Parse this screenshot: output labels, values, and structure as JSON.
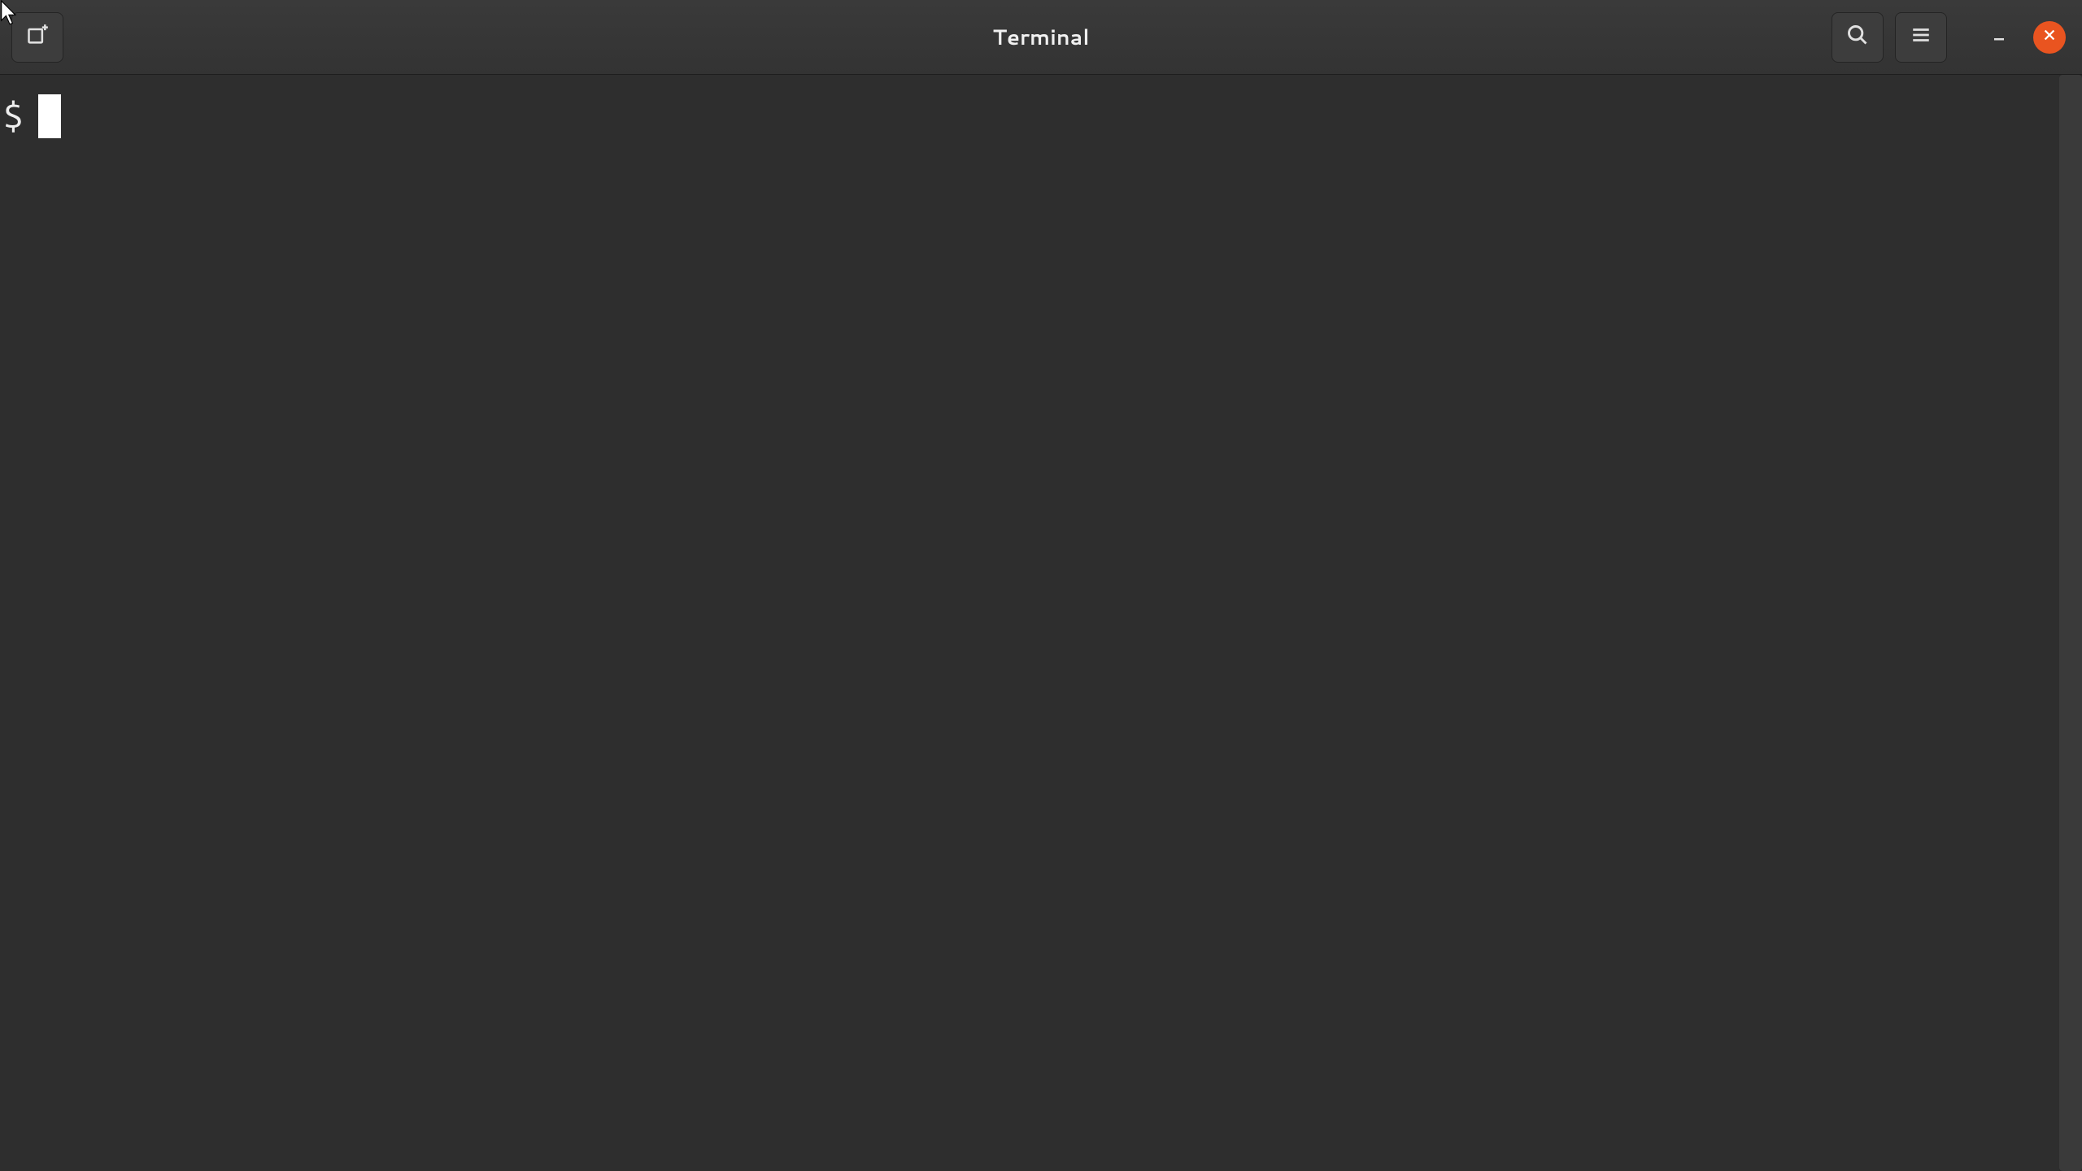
{
  "window": {
    "title": "Terminal"
  },
  "terminal": {
    "prompt": "$",
    "current_input": ""
  },
  "icons": {
    "new_tab": "new-tab-icon",
    "search": "search-icon",
    "menu": "hamburger-menu-icon",
    "minimize": "minimize-icon",
    "close": "close-icon"
  },
  "colors": {
    "accent": "#e95420",
    "background": "#2e2e2e",
    "titlebar": "#333333",
    "text": "#eeeeee"
  }
}
